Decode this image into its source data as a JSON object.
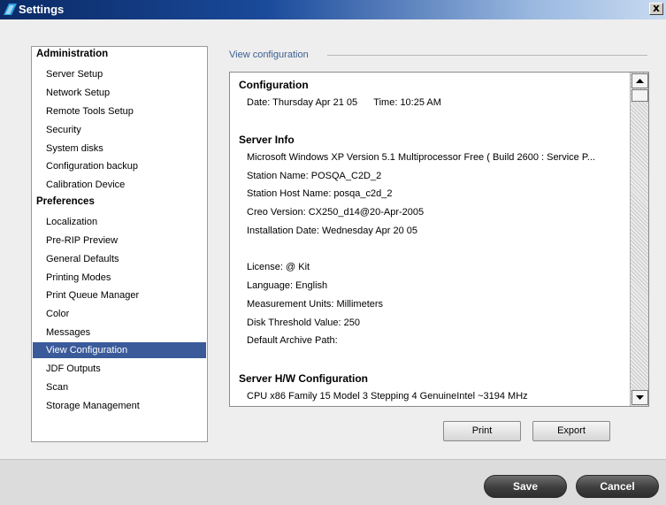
{
  "window": {
    "title": "Settings",
    "close_glyph": "x"
  },
  "nav": {
    "groups": [
      {
        "label": "Administration",
        "items": [
          "Server Setup",
          "Network Setup",
          "Remote Tools Setup",
          "Security",
          "System disks",
          "Configuration backup",
          "Calibration Device"
        ]
      },
      {
        "label": "Preferences",
        "items": [
          "Localization",
          "Pre-RIP Preview",
          "General Defaults",
          "Printing Modes",
          "Print Queue Manager",
          "Color",
          "Messages",
          "View Configuration",
          "JDF Outputs",
          "Scan",
          "Storage Management"
        ]
      }
    ],
    "selected": "View Configuration"
  },
  "view": {
    "section_title": "View configuration",
    "sections": [
      {
        "heading": "Configuration",
        "lines": [
          "Date: Thursday Apr 21 05      Time: 10:25 AM"
        ]
      },
      {
        "heading": "Server Info",
        "lines": [
          "Microsoft Windows XP Version 5.1 Multiprocessor Free ( Build 2600 : Service P...",
          "Station Name: POSQA_C2D_2",
          "Station Host Name: posqa_c2d_2",
          "Creo Version:  CX250_d14@20-Apr-2005",
          "Installation Date: Wednesday Apr 20 05",
          "",
          "License: @ Kit",
          "Language: English",
          "Measurement Units: Millimeters",
          "Disk Threshold Value: 250",
          "Default Archive Path:"
        ]
      },
      {
        "heading": "Server H/W Configuration",
        "lines": [
          "CPU x86 Family 15 Model 3 Stepping 4 GenuineIntel ~3194 MHz"
        ]
      }
    ],
    "print_label": "Print",
    "export_label": "Export"
  },
  "footer": {
    "save_label": "Save",
    "cancel_label": "Cancel"
  },
  "colors": {
    "accent": "#3a5a9a",
    "section_title": "#3b5f92",
    "titlebar": "#0b2a66"
  }
}
